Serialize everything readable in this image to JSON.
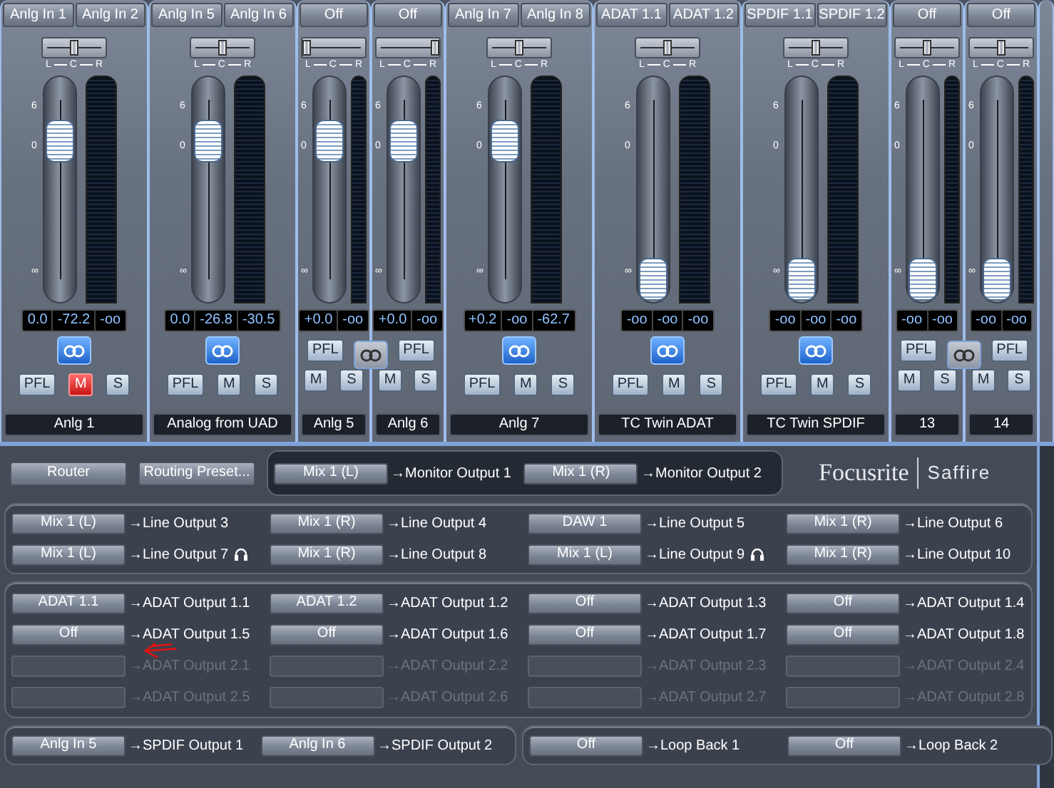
{
  "mixer": {
    "strips": [
      {
        "kind": "stereo",
        "inputs": [
          "Anlg In 1",
          "Anlg In 2"
        ],
        "pan": {
          "level": 0.5
        },
        "pan_scale": [
          "L",
          "C",
          "R"
        ],
        "fader_scale": [
          "6",
          "0",
          "∞"
        ],
        "fader": {
          "level": 0.77
        },
        "readings": [
          "0.0",
          "-72.2",
          "-oo"
        ],
        "linked": true,
        "buttons": [
          {
            "label": "PFL",
            "on": false
          },
          {
            "label": "M",
            "on": true
          },
          {
            "label": "S",
            "on": false
          }
        ],
        "name": "Anlg 1"
      },
      {
        "kind": "stereo",
        "inputs": [
          "Anlg In 5",
          "Anlg In 6"
        ],
        "pan": {
          "level": 0.5
        },
        "pan_scale": [
          "L",
          "C",
          "R"
        ],
        "fader_scale": [
          "6",
          "0",
          "∞"
        ],
        "fader": {
          "level": 0.77
        },
        "readings": [
          "0.0",
          "-26.8",
          "-30.5"
        ],
        "linked": true,
        "buttons": [
          {
            "label": "PFL",
            "on": false
          },
          {
            "label": "M",
            "on": false
          },
          {
            "label": "S",
            "on": false
          }
        ],
        "name": "Analog from UAD"
      },
      {
        "kind": "mono_pair",
        "linked": false,
        "channels": [
          {
            "input": "Off",
            "pan": {
              "level": 0
            },
            "pan_scale": [
              "L",
              "C",
              "R"
            ],
            "fader_scale": [
              "6",
              "0",
              "∞"
            ],
            "fader": {
              "level": 0.77
            },
            "readings": [
              "+0.0",
              "-oo"
            ],
            "buttons": [
              {
                "label": "PFL",
                "on": false
              },
              {
                "label": "M",
                "on": false
              },
              {
                "label": "S",
                "on": false
              }
            ],
            "name": "Anlg 5"
          },
          {
            "input": "Off",
            "pan": {
              "level": 1
            },
            "pan_scale": [
              "L",
              "C",
              "R"
            ],
            "fader_scale": [
              "6",
              "0",
              "∞"
            ],
            "fader": {
              "level": 0.77
            },
            "readings": [
              "+0.0",
              "-oo"
            ],
            "buttons": [
              {
                "label": "PFL",
                "on": false
              },
              {
                "label": "M",
                "on": false
              },
              {
                "label": "S",
                "on": false
              }
            ],
            "name": "Anlg 6"
          }
        ]
      },
      {
        "kind": "stereo",
        "inputs": [
          "Anlg In 7",
          "Anlg In 8"
        ],
        "pan": {
          "level": 0.5
        },
        "pan_scale": [
          "L",
          "C",
          "R"
        ],
        "fader_scale": [
          "6",
          "0",
          "∞"
        ],
        "fader": {
          "level": 0.77
        },
        "readings": [
          "+0.2",
          "-oo",
          "-62.7"
        ],
        "linked": true,
        "buttons": [
          {
            "label": "PFL",
            "on": false
          },
          {
            "label": "M",
            "on": false
          },
          {
            "label": "S",
            "on": false
          }
        ],
        "name": "Anlg 7"
      },
      {
        "kind": "stereo",
        "inputs": [
          "ADAT 1.1",
          "ADAT 1.2"
        ],
        "pan": {
          "level": 0.5
        },
        "pan_scale": [
          "L",
          "C",
          "R"
        ],
        "fader_scale": [
          "6",
          "0",
          "∞"
        ],
        "fader": {
          "level": 0
        },
        "readings": [
          "-oo",
          "-oo",
          "-oo"
        ],
        "linked": true,
        "buttons": [
          {
            "label": "PFL",
            "on": false
          },
          {
            "label": "M",
            "on": false
          },
          {
            "label": "S",
            "on": false
          }
        ],
        "name": "TC Twin ADAT"
      },
      {
        "kind": "stereo",
        "inputs": [
          "SPDIF 1.1",
          "SPDIF 1.2"
        ],
        "pan": {
          "level": 0.5
        },
        "pan_scale": [
          "L",
          "C",
          "R"
        ],
        "fader_scale": [
          "6",
          "0",
          "∞"
        ],
        "fader": {
          "level": 0
        },
        "readings": [
          "-oo",
          "-oo",
          "-oo"
        ],
        "linked": true,
        "buttons": [
          {
            "label": "PFL",
            "on": false
          },
          {
            "label": "M",
            "on": false
          },
          {
            "label": "S",
            "on": false
          }
        ],
        "name": "TC Twin SPDIF"
      },
      {
        "kind": "mono_pair",
        "linked": false,
        "channels": [
          {
            "input": "Off",
            "pan": {
              "level": 0.5
            },
            "pan_scale": [
              "L",
              "C",
              "R"
            ],
            "fader_scale": [
              "6",
              "0",
              "∞"
            ],
            "fader": {
              "level": 0
            },
            "readings": [
              "-oo",
              "-oo"
            ],
            "buttons": [
              {
                "label": "PFL",
                "on": false
              },
              {
                "label": "M",
                "on": false
              },
              {
                "label": "S",
                "on": false
              }
            ],
            "name": "13"
          },
          {
            "input": "Off",
            "pan": {
              "level": 0.5
            },
            "pan_scale": [
              "L",
              "C",
              "R"
            ],
            "fader_scale": [
              "6",
              "0",
              "∞"
            ],
            "fader": {
              "level": 0
            },
            "readings": [
              "-oo",
              "-oo"
            ],
            "buttons": [
              {
                "label": "PFL",
                "on": false
              },
              {
                "label": "M",
                "on": false
              },
              {
                "label": "S",
                "on": false
              }
            ],
            "name": "14"
          }
        ]
      }
    ]
  },
  "router": {
    "buttons": [
      "Router",
      "Routing Preset..."
    ],
    "monitor": [
      {
        "source": "Mix 1 (L)",
        "dest": "→Monitor Output 1"
      },
      {
        "source": "Mix 1 (R)",
        "dest": "→Monitor Output 2"
      }
    ],
    "logo": {
      "brand": "Focusrite",
      "product": "Saffire"
    },
    "line_outputs": [
      {
        "source": "Mix 1 (L)",
        "dest": "→Line Output 3",
        "headphones": false
      },
      {
        "source": "Mix 1 (R)",
        "dest": "→Line Output 4",
        "headphones": false
      },
      {
        "source": "DAW 1",
        "dest": "→Line Output 5",
        "headphones": false
      },
      {
        "source": "Mix 1 (R)",
        "dest": "→Line Output 6",
        "headphones": false
      },
      {
        "source": "Mix 1 (L)",
        "dest": "→Line Output 7",
        "headphones": true
      },
      {
        "source": "Mix 1 (R)",
        "dest": "→Line Output 8",
        "headphones": false
      },
      {
        "source": "Mix 1 (L)",
        "dest": "→Line Output 9",
        "headphones": true
      },
      {
        "source": "Mix 1 (R)",
        "dest": "→Line Output 10",
        "headphones": false
      }
    ],
    "adat_outputs": [
      {
        "source": "ADAT 1.1",
        "dest": "→ADAT Output 1.1",
        "disabled": false
      },
      {
        "source": "ADAT 1.2",
        "dest": "→ADAT Output 1.2",
        "disabled": false
      },
      {
        "source": "Off",
        "dest": "→ADAT Output 1.3",
        "disabled": false
      },
      {
        "source": "Off",
        "dest": "→ADAT Output 1.4",
        "disabled": false
      },
      {
        "source": "Off",
        "dest": "→ADAT Output 1.5",
        "disabled": false
      },
      {
        "source": "Off",
        "dest": "→ADAT Output 1.6",
        "disabled": false
      },
      {
        "source": "Off",
        "dest": "→ADAT Output 1.7",
        "disabled": false
      },
      {
        "source": "Off",
        "dest": "→ADAT Output 1.8",
        "disabled": false
      },
      {
        "dest": "→ADAT Output 2.1",
        "disabled": true
      },
      {
        "dest": "→ADAT Output 2.2",
        "disabled": true
      },
      {
        "dest": "→ADAT Output 2.3",
        "disabled": true
      },
      {
        "dest": "→ADAT Output 2.4",
        "disabled": true
      },
      {
        "dest": "→ADAT Output 2.5",
        "disabled": true
      },
      {
        "dest": "→ADAT Output 2.6",
        "disabled": true
      },
      {
        "dest": "→ADAT Output 2.7",
        "disabled": true
      },
      {
        "dest": "→ADAT Output 2.8",
        "disabled": true
      }
    ],
    "spdif": [
      {
        "source": "Anlg In 5",
        "dest": "→SPDIF Output 1"
      },
      {
        "source": "Anlg In 6",
        "dest": "→SPDIF Output 2"
      }
    ],
    "loopback": [
      {
        "source": "Off",
        "dest": "→Loop Back 1"
      },
      {
        "source": "Off",
        "dest": "→Loop Back 2"
      }
    ]
  }
}
